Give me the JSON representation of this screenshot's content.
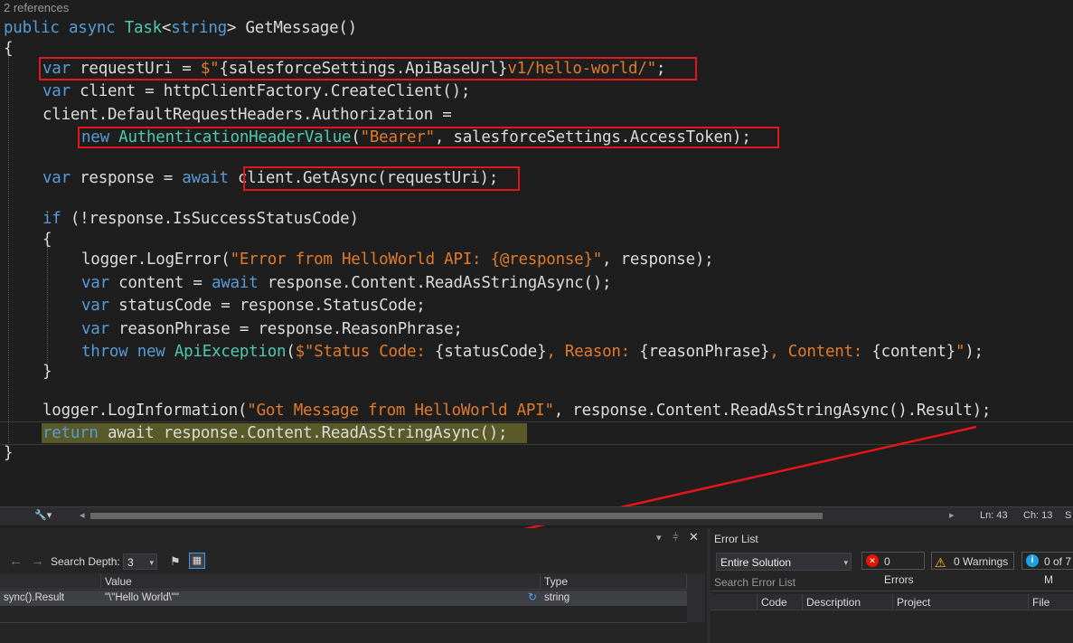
{
  "editor": {
    "references": "2 references",
    "signature": {
      "kw1": "public",
      "kw2": "async",
      "type": "Task",
      "rest1": "<",
      "kw3": "string",
      "rest2": "> GetMessage()"
    },
    "lines": {
      "l_open": "{",
      "l_var1_kw": "var",
      "l_var1_a": " requestUri = ",
      "l_var1_str1": "$\"",
      "l_var1_b": "{salesforceSettings.ApiBaseUrl}",
      "l_var1_str2": "v1/hello-world/\"",
      "l_var1_end": ";",
      "l_var2_kw": "var",
      "l_var2_rest": " client = httpClientFactory.CreateClient();",
      "l_auth": "client.DefaultRequestHeaders.Authorization =",
      "l_new_kw": "new",
      "l_new_type": "AuthenticationHeaderValue",
      "l_new_a": "(",
      "l_new_str": "\"Bearer\"",
      "l_new_b": ", salesforceSettings.AccessToken);",
      "l_resp_kw": "var",
      "l_resp_a": " response = ",
      "l_resp_await": "await",
      "l_resp_b": " client.GetAsync(requestUri);",
      "l_if_kw": "if",
      "l_if_rest": " (!response.IsSuccessStatusCode)",
      "l_open2": "{",
      "l_log1_a": "logger.LogError(",
      "l_log1_str": "\"Error from HelloWorld API: {@response}\"",
      "l_log1_b": ", response);",
      "l_content_kw": "var",
      "l_content_a": " content = ",
      "l_content_await": "await",
      "l_content_b": " response.Content.ReadAsStringAsync();",
      "l_status_kw": "var",
      "l_status_rest": " statusCode = response.StatusCode;",
      "l_reason_kw": "var",
      "l_reason_rest": " reasonPhrase = response.ReasonPhrase;",
      "l_throw_kw1": "throw",
      "l_throw_kw2": "new",
      "l_throw_type": "ApiException",
      "l_throw_a": "(",
      "l_throw_s1": "$\"Status Code: ",
      "l_throw_b": "{statusCode}",
      "l_throw_s2": ", Reason: ",
      "l_throw_c": "{reasonPhrase}",
      "l_throw_s3": ", Content: ",
      "l_throw_d": "{content}",
      "l_throw_s4": "\"",
      "l_throw_end": ");",
      "l_close2": "}",
      "l_info_a": "logger.LogInformation(",
      "l_info_str": "\"Got Message from HelloWorld API\"",
      "l_info_b": ", response.Content.ReadAsStringAsync().Result);",
      "l_ret_kw": "return",
      "l_ret_rest": " await response.Content.ReadAsStringAsync();",
      "l_close": "}"
    }
  },
  "status": {
    "ln": "Ln: 43",
    "ch": "Ch: 13",
    "extra": "S"
  },
  "watch": {
    "search_depth_label": "Search Depth:",
    "search_depth_value": "3",
    "columns": {
      "value": "Value",
      "type": "Type"
    },
    "row": {
      "name": "sync().Result",
      "value": "\"\\\"Hello World\\\"\"",
      "type": "string"
    }
  },
  "errorlist": {
    "title": "Error List",
    "scope": "Entire Solution",
    "errors": "0 Errors",
    "warnings": "0 Warnings",
    "messages": "0 of 7 M",
    "search_placeholder": "Search Error List",
    "columns": {
      "code": "Code",
      "description": "Description",
      "project": "Project",
      "file": "File"
    }
  },
  "colors": {
    "annotation_red": "#e3161b",
    "editor_bg": "#1e1e1e",
    "keyword": "#569cd6",
    "type": "#4ec9b0",
    "string": "#d69d85"
  }
}
